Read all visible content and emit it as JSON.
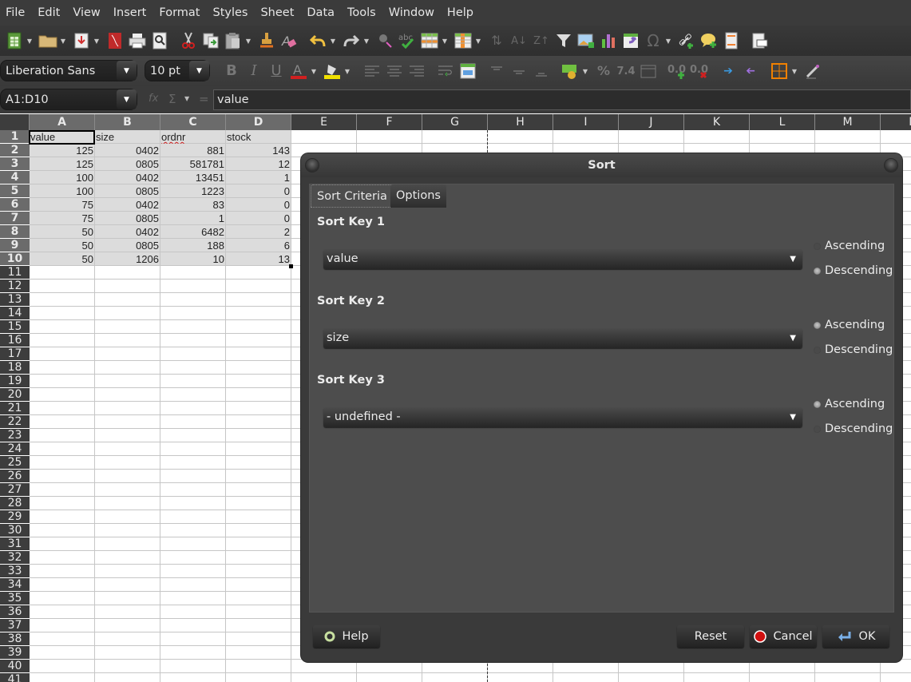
{
  "menu": [
    "File",
    "Edit",
    "View",
    "Insert",
    "Format",
    "Styles",
    "Sheet",
    "Data",
    "Tools",
    "Window",
    "Help"
  ],
  "toolbar1": {
    "icons": [
      "new-spreadsheet-icon",
      "open-folder-icon",
      "save-icon",
      "export-pdf-icon",
      "print-icon",
      "print-preview-icon",
      "cut-icon",
      "copy-icon",
      "paste-icon",
      "clone-formatting-icon",
      "clear-formatting-icon",
      "undo-icon",
      "redo-icon",
      "find-replace-icon",
      "spellcheck-icon",
      "row-icon",
      "column-icon",
      "sort-icon",
      "sort-ascending-icon",
      "sort-descending-icon",
      "autofilter-icon",
      "insert-image-icon",
      "insert-chart-icon",
      "pivot-table-icon",
      "special-character-icon",
      "hyperlink-icon",
      "comment-icon",
      "headers-footers-icon",
      "define-print-area-icon"
    ]
  },
  "toolbar2": {
    "font_name": "Liberation Sans",
    "font_size": "10 pt",
    "font_color": "#d02020",
    "highlight_color": "#f0e000",
    "border_color": "#f08000"
  },
  "formula": {
    "name_box": "A1:D10",
    "fx": "f(x)",
    "sigma": "Σ",
    "equals": "=",
    "content": "value"
  },
  "sheet": {
    "columns": [
      "A",
      "B",
      "C",
      "D",
      "E",
      "F",
      "G",
      "H",
      "I",
      "J",
      "K",
      "L",
      "M",
      "N"
    ],
    "rows": [
      "1",
      "2",
      "3",
      "4",
      "5",
      "6",
      "7",
      "8",
      "9",
      "10",
      "11",
      "12",
      "13",
      "14",
      "15",
      "16",
      "17",
      "18",
      "19",
      "20",
      "21",
      "22",
      "23",
      "24",
      "25",
      "26",
      "27",
      "28",
      "29",
      "30",
      "31",
      "32",
      "33",
      "34",
      "35",
      "36",
      "37",
      "38",
      "39",
      "40",
      "41"
    ],
    "headers": [
      "value",
      "size",
      "ordnr",
      "stock"
    ],
    "data": [
      [
        "125",
        "0402",
        "881",
        "143"
      ],
      [
        "125",
        "0805",
        "581781",
        "12"
      ],
      [
        "100",
        "0402",
        "13451",
        "1"
      ],
      [
        "100",
        "0805",
        "1223",
        "0"
      ],
      [
        "75",
        "0402",
        "83",
        "0"
      ],
      [
        "75",
        "0805",
        "1",
        "0"
      ],
      [
        "50",
        "0402",
        "6482",
        "2"
      ],
      [
        "50",
        "0805",
        "188",
        "6"
      ],
      [
        "50",
        "1206",
        "10",
        "13"
      ]
    ]
  },
  "dialog": {
    "title": "Sort",
    "tabs": [
      "Sort Criteria",
      "Options"
    ],
    "active_tab": "Sort Criteria",
    "keys": [
      {
        "label": "Sort Key 1",
        "value": "value",
        "ascending": "Ascending",
        "descending": "Descending",
        "order": "descending"
      },
      {
        "label": "Sort Key 2",
        "value": "size",
        "ascending": "Ascending",
        "descending": "Descending",
        "order": "ascending"
      },
      {
        "label": "Sort Key 3",
        "value": "- undefined -",
        "ascending": "Ascending",
        "descending": "Descending",
        "order": "ascending"
      }
    ],
    "buttons": {
      "help": "Help",
      "reset": "Reset",
      "cancel": "Cancel",
      "ok": "OK"
    }
  }
}
